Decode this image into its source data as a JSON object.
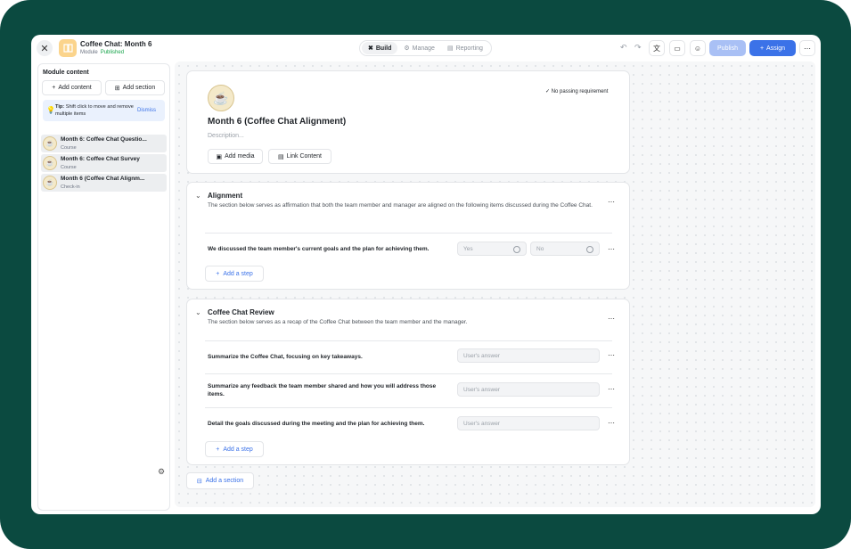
{
  "header": {
    "module_title": "Coffee Chat: Month 6",
    "module_type": "Module",
    "module_status": "Published",
    "tabs": [
      {
        "label": "Build",
        "icon": "build-icon"
      },
      {
        "label": "Manage",
        "icon": "gear-icon"
      },
      {
        "label": "Reporting",
        "icon": "document-icon"
      }
    ],
    "publish_label": "Publish",
    "assign_label": "Assign"
  },
  "sidebar": {
    "title": "Module content",
    "add_content_label": "Add content",
    "add_section_label": "Add section",
    "tip": {
      "bold": "Tip:",
      "text": "Shift click to move and remove multiple items",
      "dismiss": "Dismiss"
    },
    "items": [
      {
        "name": "Month 6: Coffee Chat Questio...",
        "type": "Course"
      },
      {
        "name": "Month 6: Coffee Chat Survey",
        "type": "Course"
      },
      {
        "name": "Month 6 (Coffee Chat Alignm...",
        "type": "Check-in"
      }
    ]
  },
  "main": {
    "title": "Month 6 (Coffee Chat Alignment)",
    "description_placeholder": "Description...",
    "add_media_label": "Add media",
    "link_content_label": "Link Content",
    "passing_label": "No passing requirement",
    "sections": [
      {
        "title": "Alignment",
        "description": "The section below serves as affirmation that both the team member and manager are aligned on the following items discussed during the Coffee Chat.",
        "questions": [
          {
            "text": "We discussed the team member's current goals and the plan for achieving them.",
            "options": [
              "Yes",
              "No"
            ]
          }
        ],
        "add_step_label": "Add a step"
      },
      {
        "title": "Coffee Chat Review",
        "description": "The section below serves as a recap of the Coffee Chat between the team member and the manager.",
        "questions": [
          {
            "text": "Summarize the Coffee Chat, focusing on key takeaways.",
            "placeholder": "User's answer"
          },
          {
            "text": "Summarize any feedback the team member shared and how you will address those items.",
            "placeholder": "User's answer"
          },
          {
            "text": "Detail the goals discussed during the meeting and the plan for achieving them.",
            "placeholder": "User's answer"
          }
        ],
        "add_step_label": "Add a step"
      }
    ],
    "add_section_label": "Add a section"
  }
}
